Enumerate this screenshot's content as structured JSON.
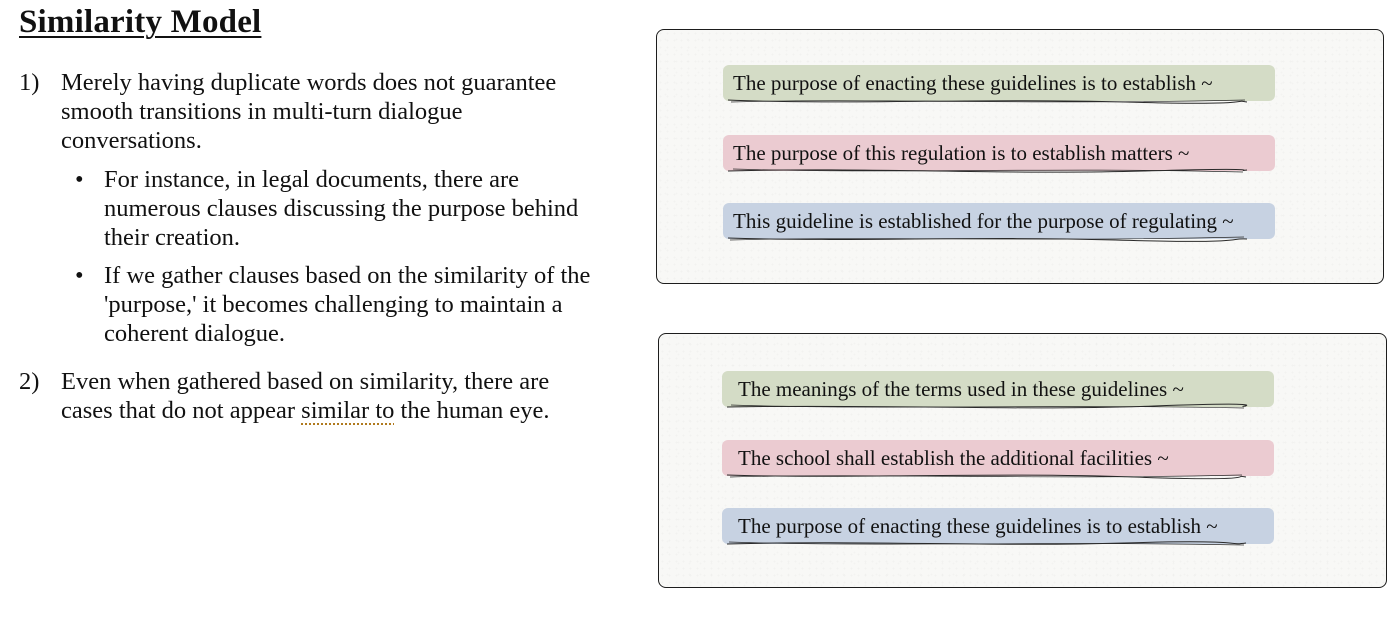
{
  "title": "Similarity Model",
  "points": [
    {
      "number": "1)",
      "text": "Merely having duplicate words does not guarantee smooth transitions in multi-turn dialogue conversations.",
      "bullets": [
        "For instance, in legal documents, there are numerous clauses discussing the purpose behind their creation.",
        "If we gather clauses based on the similarity of the 'purpose,' it becomes challenging to maintain a coherent dialogue."
      ]
    },
    {
      "number": "2)",
      "text_before": "Even when gathered based on similarity, there are cases that do not appear ",
      "text_marked": "similar to",
      "text_after": " the human eye."
    }
  ],
  "panels": [
    {
      "clauses": [
        {
          "text": "The purpose of enacting these guidelines is to establish ~",
          "color": "#d4dcc6"
        },
        {
          "text": "The purpose of this regulation is to establish matters ~",
          "color": "#ebcbd1"
        },
        {
          "text": "This guideline is established for the purpose of regulating ~",
          "color": "#c7d2e2"
        }
      ]
    },
    {
      "clauses": [
        {
          "text": "The meanings of the terms used in these guidelines  ~",
          "color": "#d4dcc6"
        },
        {
          "text": "The school shall establish the additional facilities ~",
          "color": "#ebcbd1"
        },
        {
          "text": "The purpose of enacting these guidelines is to establish ~",
          "color": "#c7d2e2"
        }
      ]
    }
  ],
  "bullet_glyph": "•"
}
